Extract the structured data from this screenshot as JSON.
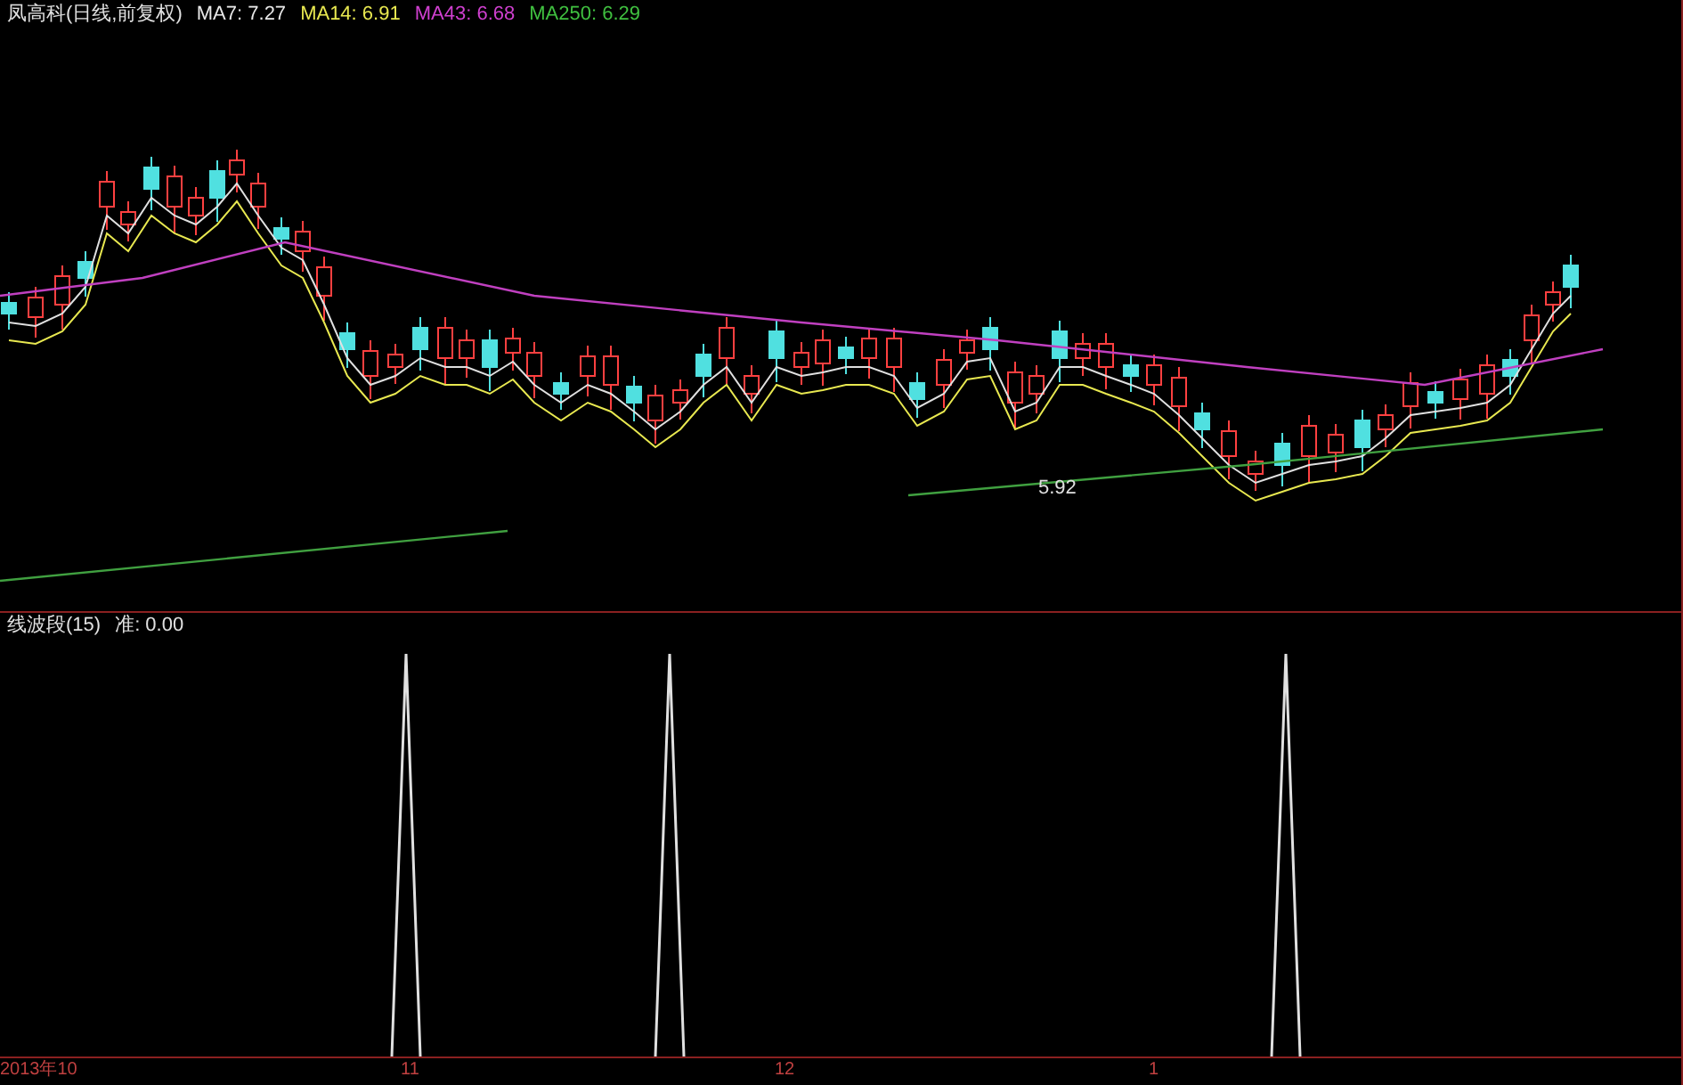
{
  "main_chart": {
    "title": "凤高科(日线,前复权)",
    "indicators": [
      {
        "label": "MA7:",
        "value": "7.27",
        "color": "#e8e8e8"
      },
      {
        "label": "MA14:",
        "value": "6.91",
        "color": "#e8e850"
      },
      {
        "label": "MA43:",
        "value": "6.68",
        "color": "#d040d0"
      },
      {
        "label": "MA250:",
        "value": "6.29",
        "color": "#40c040"
      }
    ],
    "low_label": "5.92"
  },
  "sub_chart": {
    "title": "线波段(15)",
    "reading": "准: 0.00"
  },
  "x_axis": {
    "labels": [
      "2013年10",
      "11",
      "12",
      "1"
    ]
  }
}
